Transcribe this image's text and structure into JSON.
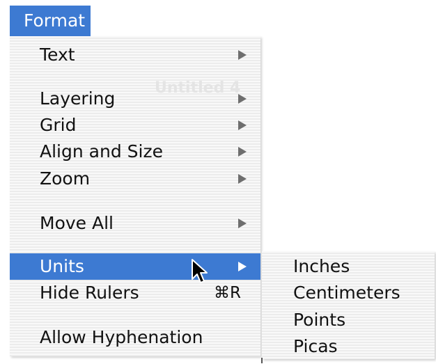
{
  "menubar": {
    "title": "Format"
  },
  "menu": {
    "items": [
      {
        "label": "Text",
        "submenu": true
      },
      {
        "label": "Layering",
        "submenu": true
      },
      {
        "label": "Grid",
        "submenu": true
      },
      {
        "label": "Align and Size",
        "submenu": true
      },
      {
        "label": "Zoom",
        "submenu": true
      },
      {
        "label": "Move All",
        "submenu": true
      },
      {
        "label": "Units",
        "submenu": true,
        "selected": true
      },
      {
        "label": "Hide Rulers",
        "shortcut": "⌘R"
      },
      {
        "label": "Allow Hyphenation"
      }
    ]
  },
  "submenu": {
    "items": [
      {
        "label": "Inches"
      },
      {
        "label": "Centimeters"
      },
      {
        "label": "Points"
      },
      {
        "label": "Picas"
      }
    ]
  },
  "background_window_title": "Untitled 4",
  "colors": {
    "selection": "#3d7ad2",
    "selection_text": "#ffffff",
    "text": "#111111"
  },
  "icons": {
    "submenu_indicator": "triangle-right",
    "pointer": "arrow-cursor"
  }
}
